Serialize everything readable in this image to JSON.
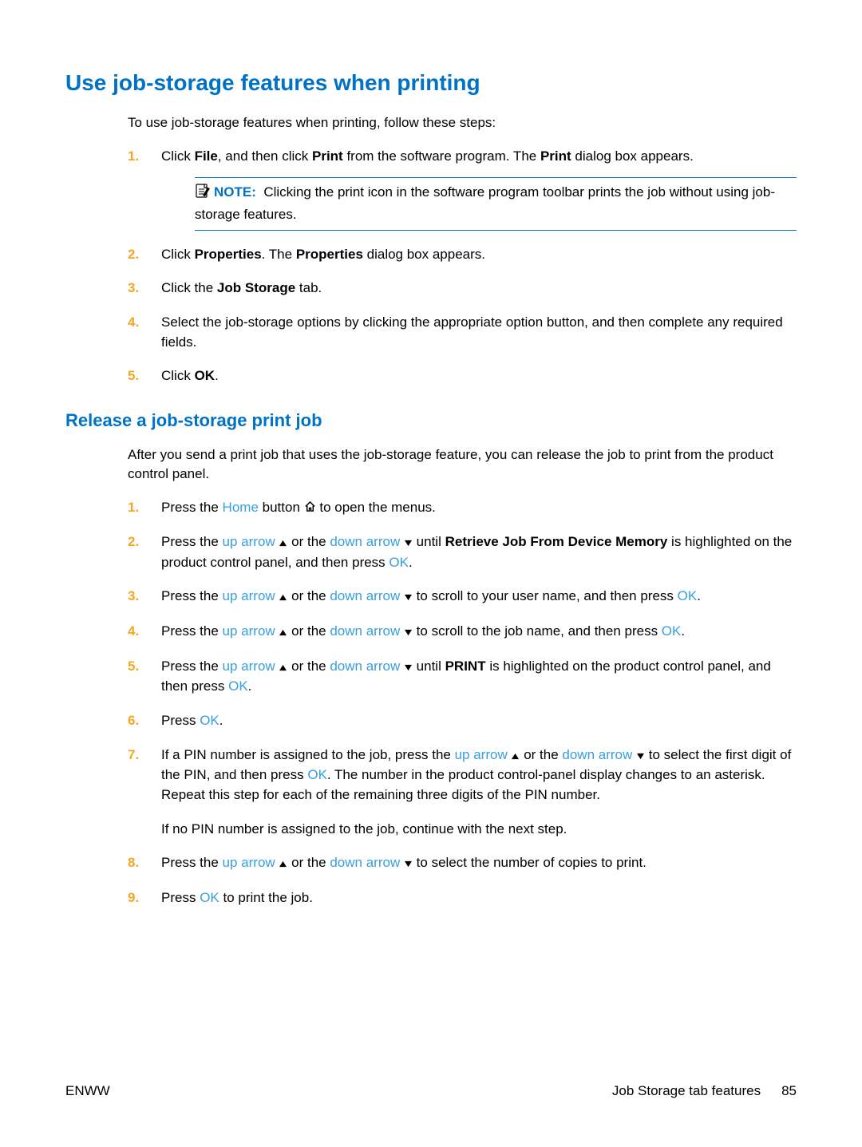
{
  "h1": "Use job-storage features when printing",
  "intro1": "To use job-storage features when printing, follow these steps:",
  "s1": {
    "n1": "1.",
    "t1a": "Click ",
    "t1b": "File",
    "t1c": ", and then click ",
    "t1d": "Print",
    "t1e": " from the software program. The ",
    "t1f": "Print",
    "t1g": " dialog box appears.",
    "noteLabel": "NOTE:",
    "noteText": "Clicking the print icon in the software program toolbar prints the job without using job-storage features.",
    "n2": "2.",
    "t2a": "Click ",
    "t2b": "Properties",
    "t2c": ". The ",
    "t2d": "Properties",
    "t2e": " dialog box appears.",
    "n3": "3.",
    "t3a": "Click the ",
    "t3b": "Job Storage",
    "t3c": " tab.",
    "n4": "4.",
    "t4": "Select the job-storage options by clicking the appropriate option button, and then complete any required fields.",
    "n5": "5.",
    "t5a": "Click ",
    "t5b": "OK",
    "t5c": "."
  },
  "h2": "Release a job-storage print job",
  "intro2": "After you send a print job that uses the job-storage feature, you can release the job to print from the product control panel.",
  "s2": {
    "n1": "1.",
    "p1a": "Press the ",
    "p1b": "Home",
    "p1c": " button ",
    "p1d": " to open the menus.",
    "n2": "2.",
    "p2a": "Press the ",
    "p2b": "up arrow",
    "p2c": " or the ",
    "p2d": "down arrow",
    "p2e": " until ",
    "p2f": "Retrieve Job From Device Memory",
    "p2g": " is highlighted on the product control panel, and then press ",
    "p2h": "OK",
    "p2i": ".",
    "n3": "3.",
    "p3a": "Press the ",
    "p3b": "up arrow",
    "p3c": " or the ",
    "p3d": "down arrow",
    "p3e": " to scroll to your user name, and then press ",
    "p3f": "OK",
    "p3g": ".",
    "n4": "4.",
    "p4a": "Press the ",
    "p4b": "up arrow",
    "p4c": " or the ",
    "p4d": "down arrow",
    "p4e": " to scroll to the job name, and then press ",
    "p4f": "OK",
    "p4g": ".",
    "n5": "5.",
    "p5a": "Press the ",
    "p5b": "up arrow",
    "p5c": " or the ",
    "p5d": "down arrow",
    "p5e": " until ",
    "p5f": "PRINT",
    "p5g": " is highlighted on the product control panel, and then press ",
    "p5h": "OK",
    "p5i": ".",
    "n6": "6.",
    "p6a": "Press ",
    "p6b": "OK",
    "p6c": ".",
    "n7": "7.",
    "p7a": "If a PIN number is assigned to the job, press the ",
    "p7b": "up arrow",
    "p7c": " or the ",
    "p7d": "down arrow",
    "p7e": " to select the first digit of the PIN, and then press ",
    "p7f": "OK",
    "p7g": ". The number in the product control-panel display changes to an asterisk. Repeat this step for each of the remaining three digits of the PIN number.",
    "p7h": "If no PIN number is assigned to the job, continue with the next step.",
    "n8": "8.",
    "p8a": "Press the ",
    "p8b": "up arrow",
    "p8c": " or the ",
    "p8d": "down arrow",
    "p8e": " to select the number of copies to print.",
    "n9": "9.",
    "p9a": "Press ",
    "p9b": "OK",
    "p9c": " to print the job."
  },
  "footer": {
    "left": "ENWW",
    "rightLabel": "Job Storage tab features",
    "pageNum": "85"
  }
}
